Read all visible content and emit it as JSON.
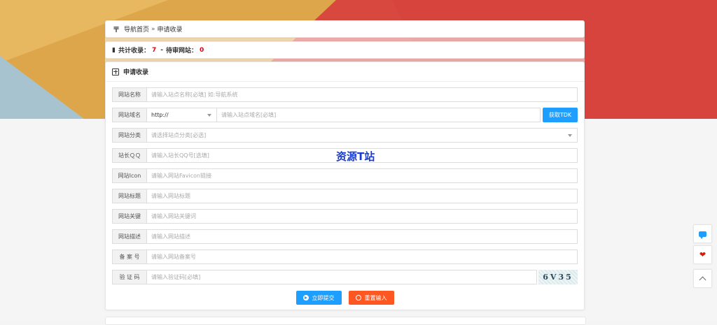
{
  "breadcrumb": {
    "home": "导航首页",
    "separator": "»",
    "current": "申请收录"
  },
  "stats": {
    "total_label": "共计收录：",
    "total": "7",
    "dash": "-",
    "pending_label": "待审网站：",
    "pending": "0"
  },
  "form": {
    "title": "申请收录",
    "fields": [
      {
        "label": "网站名称",
        "placeholder": "请输入站点名称[必填] 如:导航系统"
      },
      {
        "label": "网站域名",
        "protocol": "http://",
        "placeholder": "请输入站点域名[必填]",
        "button": "获取TDK"
      },
      {
        "label": "网站分类",
        "placeholder": "请选择站点分类[必选]"
      },
      {
        "label": "站长ＱＱ",
        "placeholder": "请输入站长QQ号[选填]"
      },
      {
        "label": "网站Icon",
        "placeholder": "请输入网站Favicon链接"
      },
      {
        "label": "网站标题",
        "placeholder": "请输入网站标题"
      },
      {
        "label": "网站关键",
        "placeholder": "请输入网站关键词"
      },
      {
        "label": "网站描述",
        "placeholder": "请输入网站描述"
      },
      {
        "label": "备 案 号",
        "placeholder": "请输入网站备案号"
      },
      {
        "label": "验 证 码",
        "placeholder": "请输入验证码[必填]",
        "captcha": "6V35"
      }
    ],
    "submit": "立即提交",
    "reset": "重置输入"
  },
  "watermark": "资源T站",
  "colors": {
    "primary": "#1e9fff",
    "danger": "#ff5722",
    "count": "#e60012"
  },
  "side_icons": [
    "chat-icon",
    "heart-icon",
    "arrow-up-icon"
  ]
}
